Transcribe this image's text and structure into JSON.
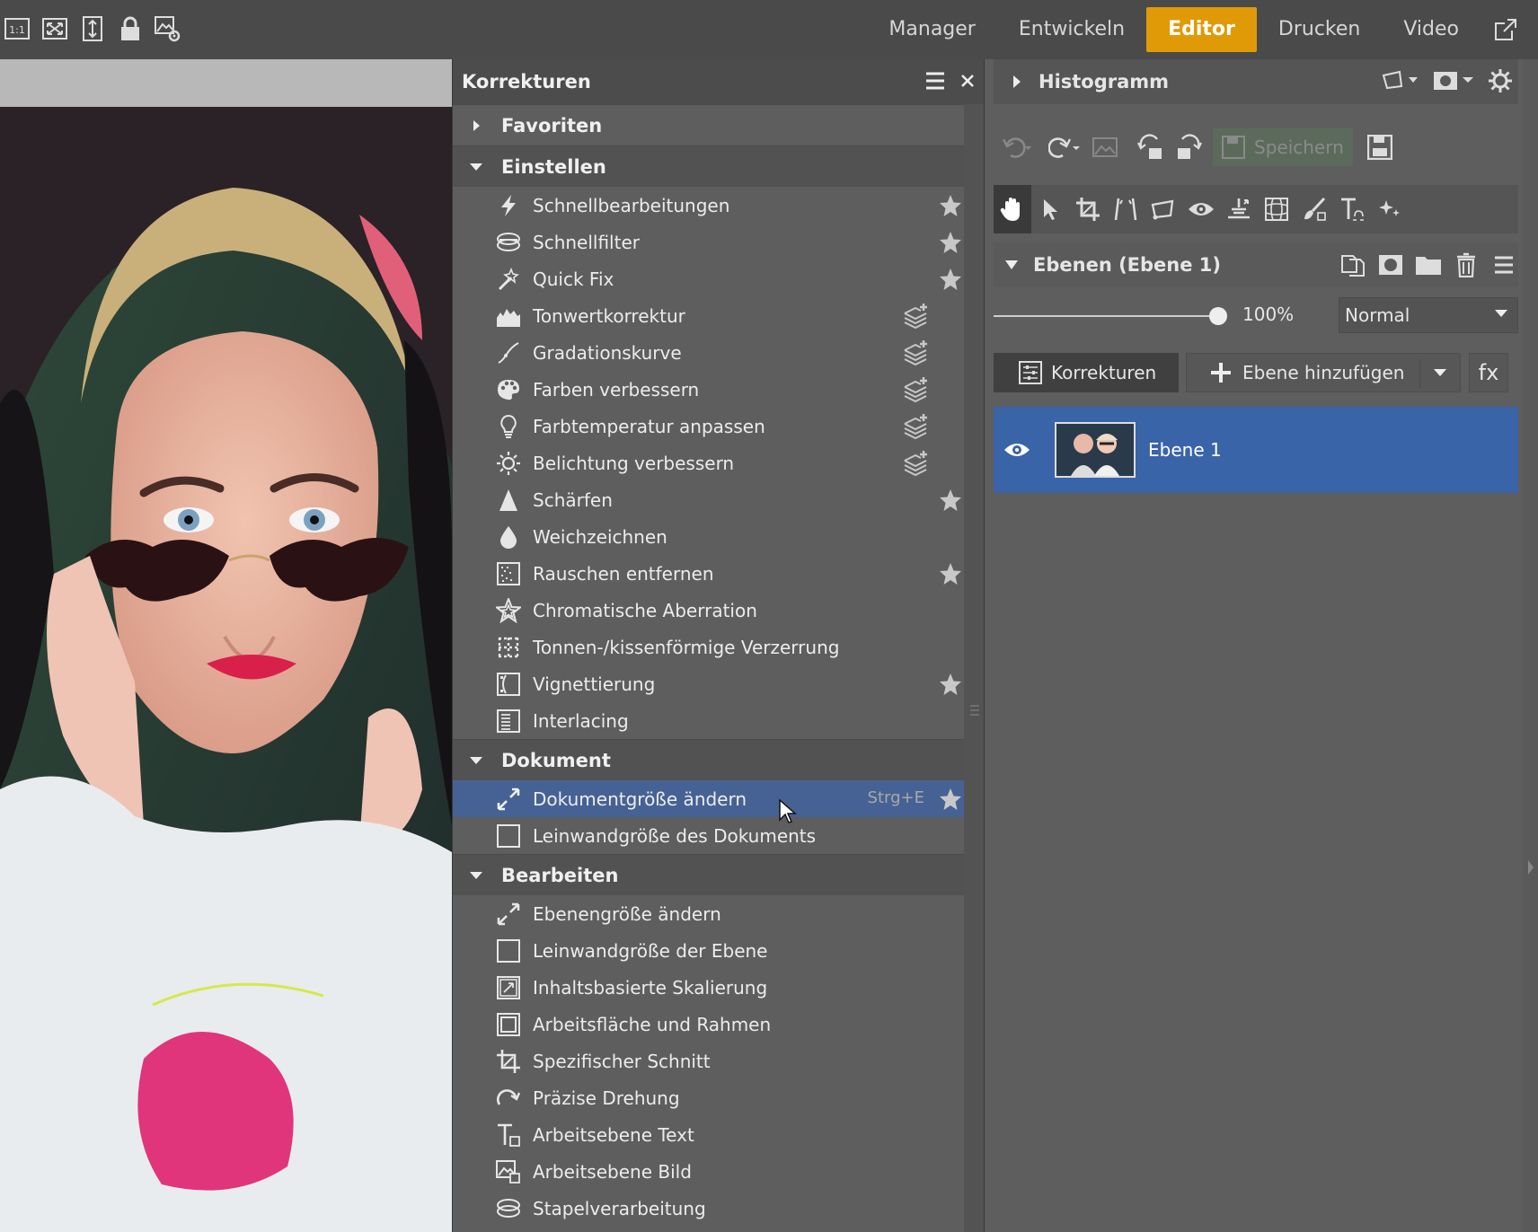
{
  "app": {
    "nav_tabs": [
      "Manager",
      "Entwickeln",
      "Editor",
      "Drucken",
      "Video"
    ]
  },
  "toolbar": {
    "icons": [
      "one-to-one-icon",
      "fit-screen-icon",
      "fit-height-icon",
      "lock-icon",
      "image-settings-icon"
    ]
  },
  "panel": {
    "title": "Korrekturen",
    "sections": {
      "favoriten": "Favoriten",
      "einstellen": "Einstellen",
      "dokument": "Dokument",
      "bearbeiten": "Bearbeiten"
    },
    "einstellen_items": [
      "Schnellbearbeitungen",
      "Schnellfilter",
      "Quick Fix",
      "Tonwertkorrektur",
      "Gradationskurve",
      "Farben verbessern",
      "Farbtemperatur anpassen",
      "Belichtung verbessern",
      "Schärfen",
      "Weichzeichnen",
      "Rauschen entfernen",
      "Chromatische Aberration",
      "Tonnen-/kissenförmige Verzerrung",
      "Vignettierung",
      "Interlacing"
    ],
    "dokument_items": [
      "Dokumentgröße ändern",
      "Leinwandgröße des Dokuments"
    ],
    "dokument_shortcut": "Strg+E",
    "bearbeiten_items": [
      "Ebenengröße ändern",
      "Leinwandgröße der Ebene",
      "Inhaltsbasierte Skalierung",
      "Arbeitsfläche und Rahmen",
      "Spezifischer Schnitt",
      "Präzise Drehung",
      "Arbeitsebene Text",
      "Arbeitsebene Bild",
      "Stapelverarbeitung"
    ]
  },
  "right": {
    "histogram_title": "Histogramm",
    "save_label": "Speichern",
    "layers_title": "Ebenen (Ebene 1)",
    "opacity": "100%",
    "opacity_value": 1.0,
    "blend_mode": "Normal",
    "korrekturen_button": "Korrekturen",
    "add_layer_button": "Ebene hinzufügen",
    "fx_button": "fx",
    "layer_name": "Ebene 1"
  },
  "colors": {
    "accent": "#e09a08",
    "selection": "#466294",
    "layer_selected": "#3a64a8"
  }
}
